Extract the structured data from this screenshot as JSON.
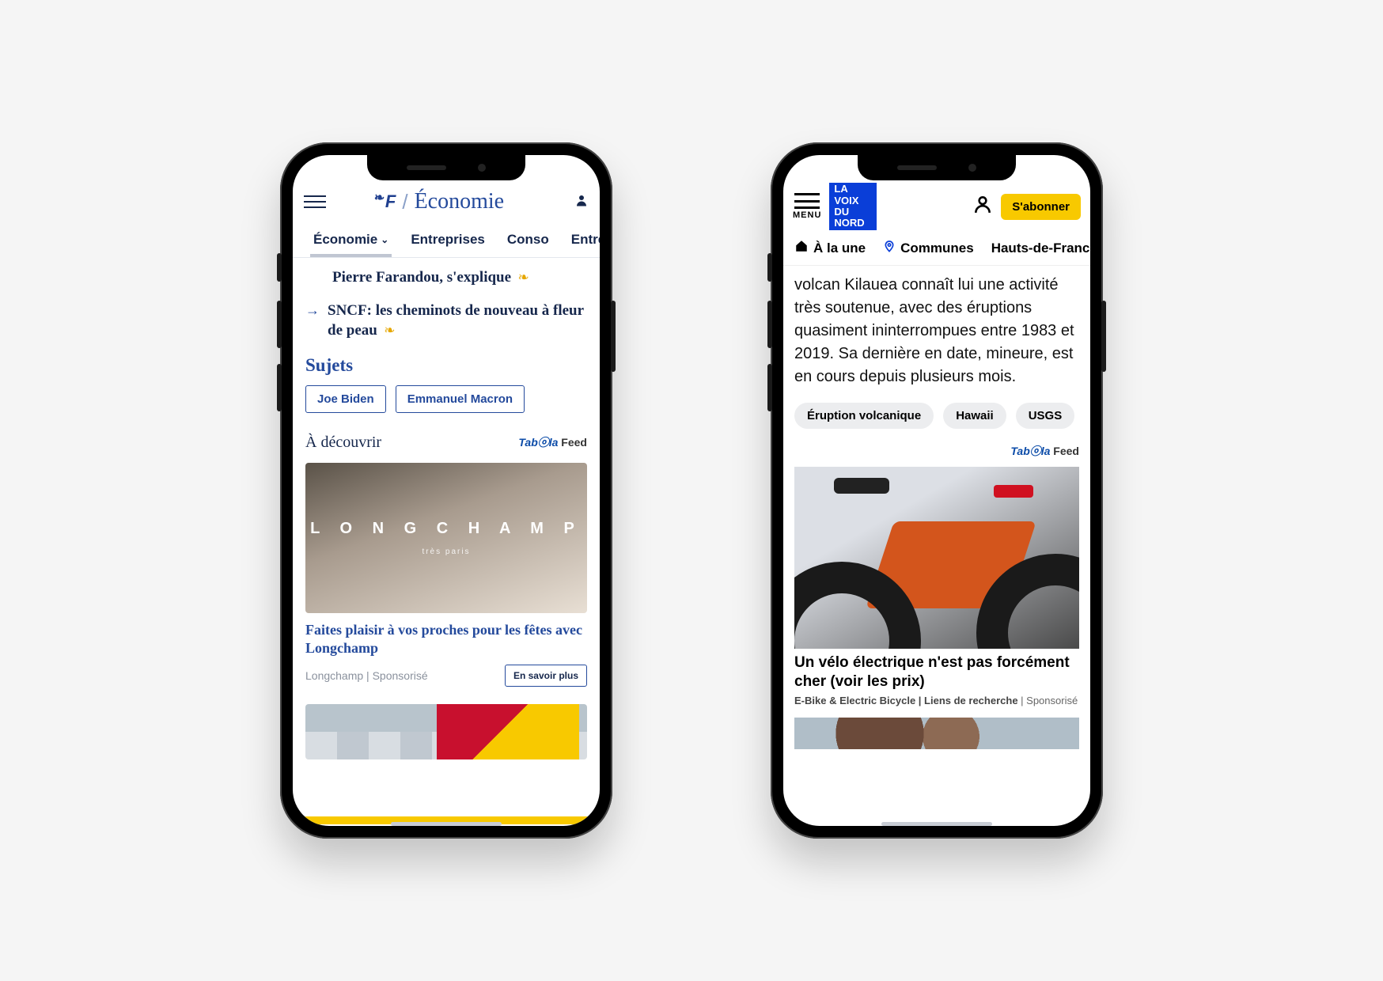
{
  "phone1": {
    "section_title": "Économie",
    "tabs": [
      {
        "label": "Économie",
        "active": true,
        "has_chevron": true
      },
      {
        "label": "Entreprises"
      },
      {
        "label": "Conso"
      },
      {
        "label": "Entrep"
      }
    ],
    "articles": [
      {
        "title": "Pierre Farandou, s'explique",
        "premium": true
      },
      {
        "title": "SNCF: les cheminots de nouveau à fleur de peau",
        "premium": true
      }
    ],
    "sujets_heading": "Sujets",
    "sujets": [
      "Joe Biden",
      "Emmanuel Macron"
    ],
    "discover_heading": "À découvrir",
    "taboola_label": "Tabⓞla Feed",
    "ad1": {
      "brand_overlay": "L O N G C H A M P",
      "brand_sub": "très paris",
      "title": "Faites plaisir à vos proches pour les fêtes avec Longchamp",
      "sponsor": "Longchamp | Sponsorisé",
      "cta": "En savoir plus"
    }
  },
  "phone2": {
    "menu_label": "MENU",
    "logo_lines": [
      "LA",
      "VOIX",
      "DU",
      "NORD"
    ],
    "subscribe_label": "S'abonner",
    "tabs": [
      {
        "label": "À la une",
        "icon": "home"
      },
      {
        "label": "Communes",
        "icon": "pin"
      },
      {
        "label": "Hauts-de-France"
      }
    ],
    "article_text": "volcan Kilauea connaît lui une activité très soutenue, avec des éruptions quasiment ininterrompues entre 1983 et 2019. Sa dernière en date, mineure, est en cours depuis plusieurs mois.",
    "tags": [
      "Éruption volcanique",
      "Hawaii",
      "USGS"
    ],
    "taboola_label": "Tabⓞla Feed",
    "ad1": {
      "title": "Un vélo électrique n'est pas forcément cher (voir les prix)",
      "sponsor": "E-Bike & Electric Bicycle | Liens de recherche",
      "sponsored": " | Sponsorisé"
    }
  }
}
